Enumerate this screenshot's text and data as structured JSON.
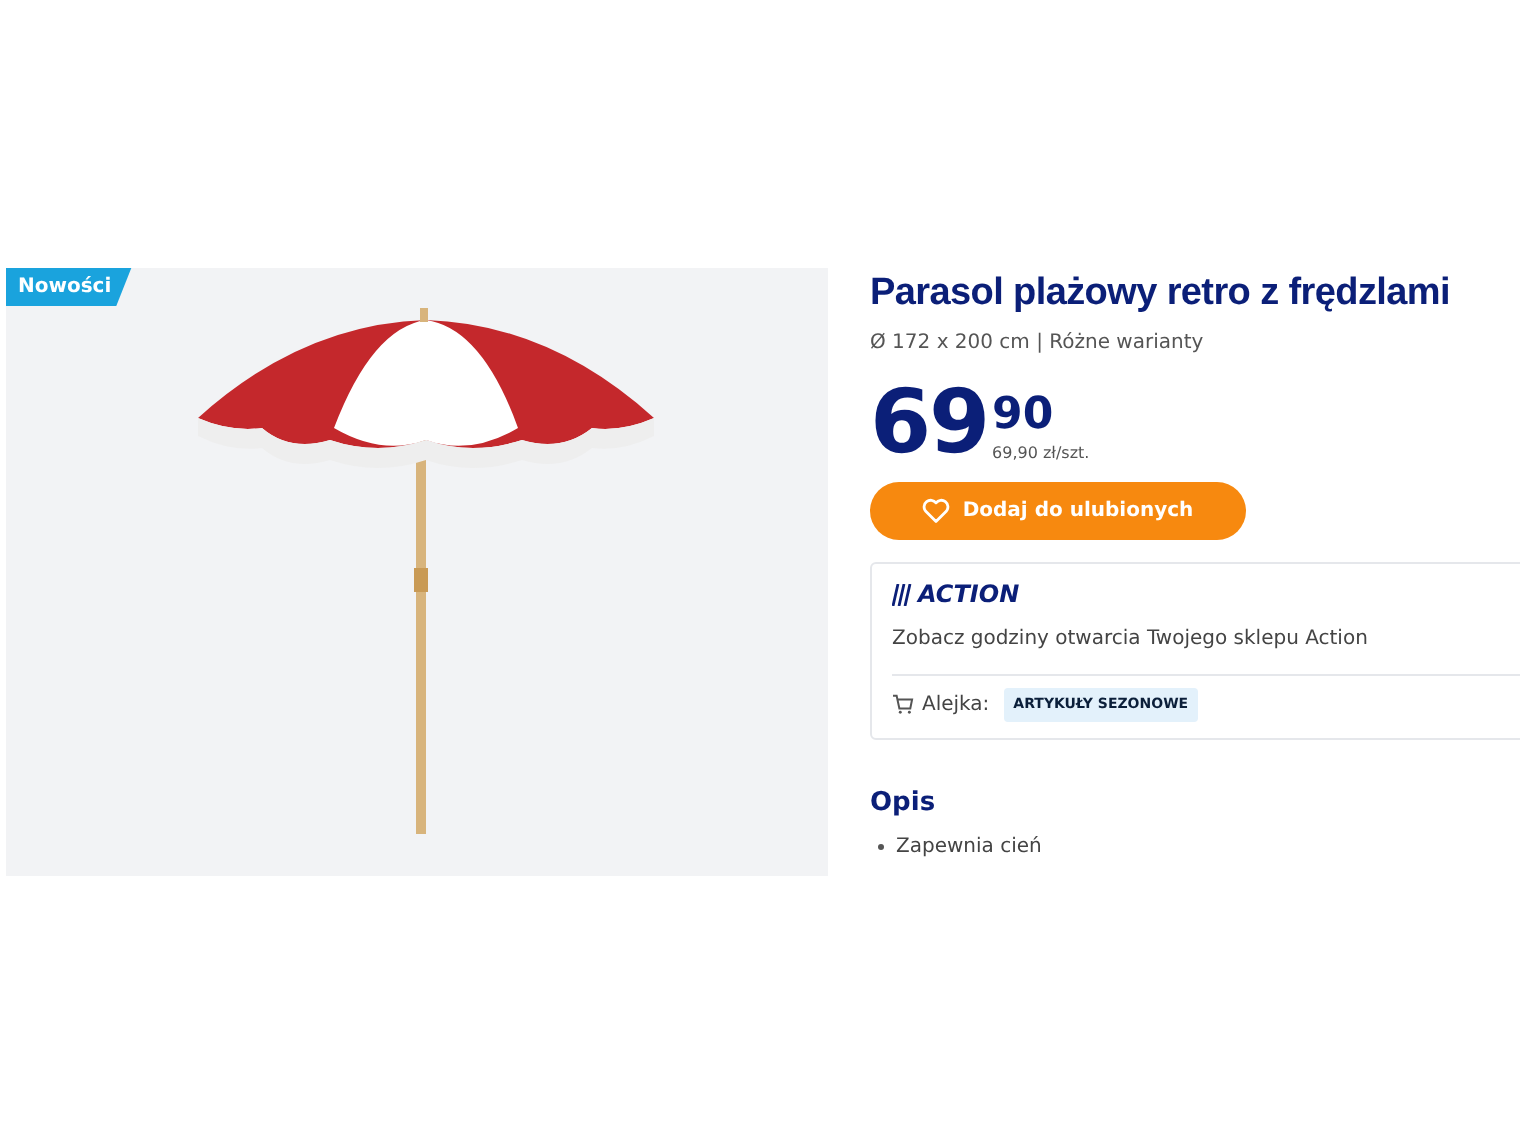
{
  "product_image": {
    "badge": "Nowości"
  },
  "product": {
    "title": "Parasol plażowy retro z frędzlami",
    "subtitle": "Ø 172 x 200 cm | Różne warianty"
  },
  "price": {
    "whole": "69",
    "fraction": "90",
    "unit_price": "69,90 zł/szt."
  },
  "favorite_button": {
    "label": "Dodaj do ulubionych"
  },
  "store_card": {
    "logo": "ACTION",
    "hours_text": "Zobacz godziny otwarcia Twojego sklepu Action",
    "aisle_label": "Alejka:",
    "aisle_tag": "ARTYKUŁY SEZONOWE"
  },
  "description": {
    "heading": "Opis",
    "items": [
      "Zapewnia cień"
    ]
  }
}
